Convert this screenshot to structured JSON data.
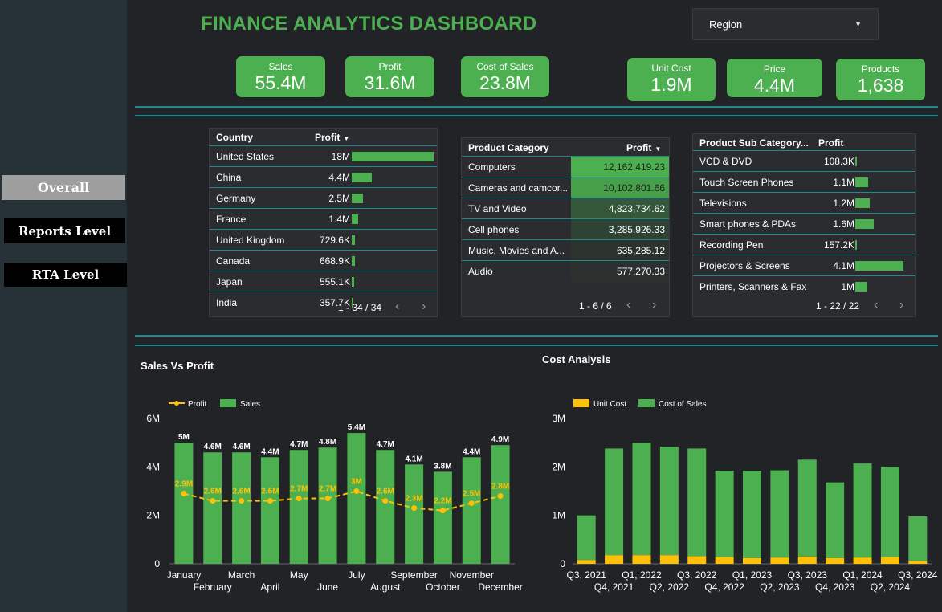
{
  "title": "FINANCE ANALYTICS DASHBOARD",
  "region_filter": {
    "label": "Region"
  },
  "nav": [
    {
      "label": "Overall",
      "active": true
    },
    {
      "label": "Reports Level"
    },
    {
      "label": "RTA Level"
    }
  ],
  "kpis": [
    {
      "label": "Sales",
      "value": "55.4M"
    },
    {
      "label": "Profit",
      "value": "31.6M"
    },
    {
      "label": "Cost of Sales",
      "value": "23.8M"
    },
    {
      "label": "Unit Cost",
      "value": "1.9M"
    },
    {
      "label": "Price",
      "value": "4.4M"
    },
    {
      "label": "Products",
      "value": "1,638"
    }
  ],
  "country_table": {
    "headers": [
      "Country",
      "Profit"
    ],
    "rows": [
      {
        "name": "United States",
        "value": "18M",
        "profit": 18.0
      },
      {
        "name": "China",
        "value": "4.4M",
        "profit": 4.4
      },
      {
        "name": "Germany",
        "value": "2.5M",
        "profit": 2.5
      },
      {
        "name": "France",
        "value": "1.4M",
        "profit": 1.4
      },
      {
        "name": "United Kingdom",
        "value": "729.6K",
        "profit": 0.7296
      },
      {
        "name": "Canada",
        "value": "668.9K",
        "profit": 0.6689
      },
      {
        "name": "Japan",
        "value": "555.1K",
        "profit": 0.5551
      },
      {
        "name": "India",
        "value": "357.7K",
        "profit": 0.3577
      }
    ],
    "pager": "1 - 34 / 34"
  },
  "category_table": {
    "headers": [
      "Product Category",
      "Profit"
    ],
    "rows": [
      {
        "name": "Computers",
        "value": "12,162,419.23"
      },
      {
        "name": "Cameras and camcor...",
        "value": "10,102,801.66"
      },
      {
        "name": "TV and Video",
        "value": "4,823,734.62"
      },
      {
        "name": "Cell phones",
        "value": "3,285,926.33"
      },
      {
        "name": "Music, Movies and A...",
        "value": "635,285.12"
      },
      {
        "name": "Audio",
        "value": "577,270.33"
      }
    ],
    "pager": "1 - 6 / 6"
  },
  "subcategory_table": {
    "headers": [
      "Product Sub Category...",
      "Profit"
    ],
    "rows": [
      {
        "name": "VCD & DVD",
        "value": "108.3K",
        "profit": 0.1083
      },
      {
        "name": "Touch Screen Phones",
        "value": "1.1M",
        "profit": 1.1
      },
      {
        "name": "Televisions",
        "value": "1.2M",
        "profit": 1.2
      },
      {
        "name": "Smart phones & PDAs",
        "value": "1.6M",
        "profit": 1.6
      },
      {
        "name": "Recording Pen",
        "value": "157.2K",
        "profit": 0.1572
      },
      {
        "name": "Projectors & Screens",
        "value": "4.1M",
        "profit": 4.1
      },
      {
        "name": "Printers, Scanners & Fax",
        "value": "1M",
        "profit": 1.0
      }
    ],
    "pager": "1 - 22 / 22"
  },
  "chart_data": [
    {
      "type": "bar",
      "title": "Sales Vs Profit",
      "legend": [
        "Profit",
        "Sales"
      ],
      "legend_position": "top-left",
      "categories": [
        "January",
        "February",
        "March",
        "April",
        "May",
        "June",
        "July",
        "August",
        "September",
        "October",
        "November",
        "December"
      ],
      "series": [
        {
          "name": "Sales",
          "type": "bar",
          "values": [
            5.0,
            4.6,
            4.6,
            4.4,
            4.7,
            4.8,
            5.4,
            4.7,
            4.1,
            3.8,
            4.4,
            4.9
          ],
          "labels": [
            "5M",
            "4.6M",
            "4.6M",
            "4.4M",
            "4.7M",
            "4.8M",
            "5.4M",
            "4.7M",
            "4.1M",
            "3.8M",
            "4.4M",
            "4.9M"
          ],
          "color": "#4caf50"
        },
        {
          "name": "Profit",
          "type": "line",
          "values": [
            2.9,
            2.6,
            2.6,
            2.6,
            2.7,
            2.7,
            3.0,
            2.6,
            2.3,
            2.2,
            2.5,
            2.8
          ],
          "labels": [
            "2.9M",
            "2.6M",
            "2.6M",
            "2.6M",
            "2.7M",
            "2.7M",
            "3M",
            "2.6M",
            "2.3M",
            "2.2M",
            "2.5M",
            "2.8M"
          ],
          "color": "#ffc107"
        }
      ],
      "yticks": [
        "0",
        "2M",
        "4M",
        "6M"
      ],
      "ylim": [
        0,
        6
      ]
    },
    {
      "type": "bar",
      "title": "Cost Analysis",
      "legend": [
        "Unit Cost",
        "Cost of Sales"
      ],
      "legend_position": "top-left",
      "stacked": true,
      "categories": [
        "Q3, 2021",
        "Q4, 2021",
        "Q1, 2022",
        "Q2, 2022",
        "Q3, 2022",
        "Q4, 2022",
        "Q1, 2023",
        "Q2, 2023",
        "Q3, 2023",
        "Q4, 2023",
        "Q1, 2024",
        "Q2, 2024",
        "Q3, 2024"
      ],
      "series": [
        {
          "name": "Unit Cost",
          "values": [
            0.08,
            0.18,
            0.18,
            0.18,
            0.16,
            0.14,
            0.12,
            0.13,
            0.15,
            0.12,
            0.13,
            0.14,
            0.06
          ],
          "color": "#ffc107"
        },
        {
          "name": "Cost of Sales",
          "values": [
            0.92,
            2.2,
            2.32,
            2.24,
            2.22,
            1.78,
            1.8,
            1.8,
            2.0,
            1.56,
            1.94,
            1.86,
            0.92
          ],
          "color": "#4caf50"
        }
      ],
      "yticks": [
        "0",
        "1M",
        "2M",
        "3M"
      ],
      "ylim": [
        0,
        3
      ]
    }
  ]
}
